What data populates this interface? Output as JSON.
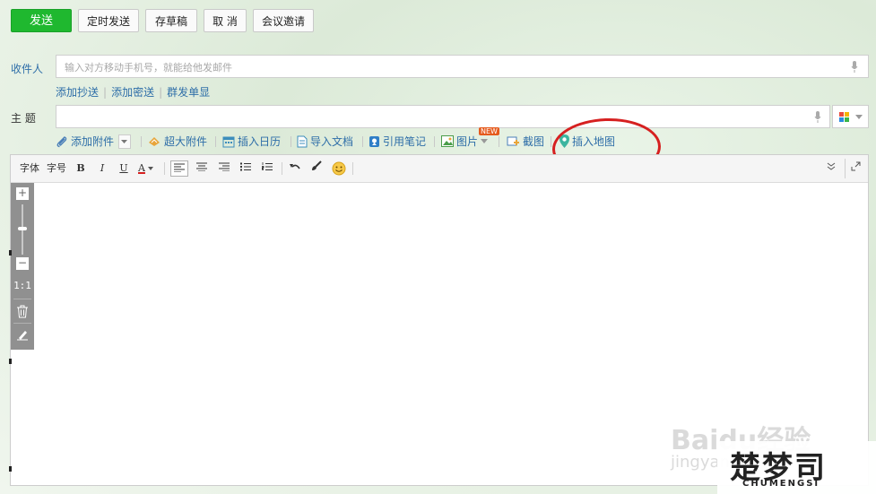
{
  "topbar": {
    "send": "发送",
    "scheduled": "定时发送",
    "draft": "存草稿",
    "cancel": "取 消",
    "meeting": "会议邀请"
  },
  "recipient": {
    "label": "收件人",
    "placeholder": "输入对方移动手机号，就能给他发邮件"
  },
  "recipient_links": [
    "添加抄送",
    "添加密送",
    "群发单显"
  ],
  "subject": {
    "label": "主 题",
    "value": ""
  },
  "attach_toolbar": {
    "add_attachment": "添加附件",
    "big_attachment": "超大附件",
    "insert_calendar": "插入日历",
    "import_doc": "导入文档",
    "quote_note": "引用笔记",
    "picture": "图片",
    "new_badge": "NEW",
    "screenshot": "截图",
    "insert_map": "插入地图"
  },
  "editor_toolbar": {
    "font": "字体",
    "size": "字号",
    "bold": "B",
    "italic": "I",
    "underline": "U",
    "font_color": "A"
  },
  "zoom_panel": {
    "ratio": "1:1"
  },
  "watermark": {
    "baidu": "Baidu经验",
    "jingyan": "jingyan",
    "logo_text": "楚梦司",
    "logo_sub": "CHUMENGSI"
  },
  "colors": {
    "send_green": "#1fb82f",
    "link_blue": "#2e6ea8",
    "annotation_red": "#d62020"
  }
}
